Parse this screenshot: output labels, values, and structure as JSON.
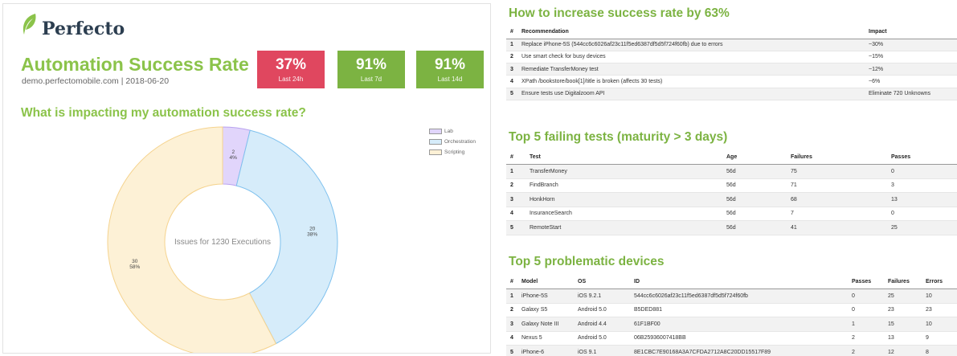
{
  "brand": {
    "name": "Perfecto",
    "color": "#8bc34a"
  },
  "header": {
    "title": "Automation Success Rate",
    "subtitle": "demo.perfectomobile.com | 2018-06-20"
  },
  "kpis": [
    {
      "value": "37%",
      "label": "Last 24h",
      "color": "#e0475f"
    },
    {
      "value": "91%",
      "label": "Last 7d",
      "color": "#7cb342"
    },
    {
      "value": "91%",
      "label": "Last 14d",
      "color": "#7cb342"
    }
  ],
  "impact_section": {
    "title": "What is impacting my automation success rate?"
  },
  "chart_data": {
    "type": "pie",
    "donut": true,
    "center_label": "Issues for 1230 Executions",
    "legend_position": "top-right",
    "series": [
      {
        "name": "Lab",
        "value": 2,
        "percent": "4%",
        "color": "#e1d5fb"
      },
      {
        "name": "Orchestration",
        "value": 20,
        "percent": "38%",
        "color": "#d6ecfa"
      },
      {
        "name": "Scripting",
        "value": 30,
        "percent": "58%",
        "color": "#fdf1d6"
      }
    ]
  },
  "recommendations": {
    "title": "How to increase success rate by 63%",
    "columns": [
      "#",
      "Recommendation",
      "Impact"
    ],
    "rows": [
      {
        "num": "1",
        "text": "Replace iPhone-5S (544cc6c6026af23c11f5ed6387df5d5f724f60fb) due to errors",
        "impact": "~30%"
      },
      {
        "num": "2",
        "text": "Use smart check for busy devices",
        "impact": "~15%"
      },
      {
        "num": "3",
        "text": "Remediate TransferMoney test",
        "impact": "~12%"
      },
      {
        "num": "4",
        "text": "XPath /bookstore/book[1]/title is broken (affects 30 tests)",
        "impact": "~6%"
      },
      {
        "num": "5",
        "text": "Ensure tests use Digitalzoom API",
        "impact": "Eliminate 720 Unknowns"
      }
    ]
  },
  "failing_tests": {
    "title": "Top 5 failing tests (maturity > 3 days)",
    "columns": [
      "#",
      "Test",
      "Age",
      "Failures",
      "Passes"
    ],
    "rows": [
      {
        "num": "1",
        "test": "TransferMoney",
        "age": "56d",
        "failures": "75",
        "passes": "0"
      },
      {
        "num": "2",
        "test": "FindBranch",
        "age": "56d",
        "failures": "71",
        "passes": "3"
      },
      {
        "num": "3",
        "test": "HonkHorn",
        "age": "56d",
        "failures": "68",
        "passes": "13"
      },
      {
        "num": "4",
        "test": "InsuranceSearch",
        "age": "56d",
        "failures": "7",
        "passes": "0"
      },
      {
        "num": "5",
        "test": "RemoteStart",
        "age": "56d",
        "failures": "41",
        "passes": "25"
      }
    ]
  },
  "devices": {
    "title": "Top 5 problematic devices",
    "columns": [
      "#",
      "Model",
      "OS",
      "ID",
      "Passes",
      "Failures",
      "Errors"
    ],
    "rows": [
      {
        "num": "1",
        "model": "iPhone-5S",
        "os": "iOS 9.2.1",
        "id": "544cc6c6026af23c11f5ed6387df5d5f724f60fb",
        "passes": "0",
        "failures": "25",
        "errors": "10"
      },
      {
        "num": "2",
        "model": "Galaxy S5",
        "os": "Android 5.0",
        "id": "B5DED881",
        "passes": "0",
        "failures": "23",
        "errors": "23"
      },
      {
        "num": "3",
        "model": "Galaxy Note III",
        "os": "Android 4.4",
        "id": "61F1BF00",
        "passes": "1",
        "failures": "15",
        "errors": "10"
      },
      {
        "num": "4",
        "model": "Nexus 5",
        "os": "Android 5.0",
        "id": "06B25936007418BB",
        "passes": "2",
        "failures": "13",
        "errors": "9"
      },
      {
        "num": "5",
        "model": "iPhone-6",
        "os": "iOS 9.1",
        "id": "8E1CBC7E90168A3A7CFDA2712A8C20DD15517F89",
        "passes": "2",
        "failures": "12",
        "errors": "8"
      }
    ]
  }
}
